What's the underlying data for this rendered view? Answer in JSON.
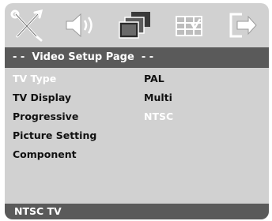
{
  "toolbar": {
    "icons": [
      {
        "name": "general-setup-icon"
      },
      {
        "name": "audio-setup-icon"
      },
      {
        "name": "video-setup-icon"
      },
      {
        "name": "preference-setup-icon"
      },
      {
        "name": "exit-setup-icon"
      }
    ]
  },
  "page": {
    "title": "- -  Video Setup Page  - -"
  },
  "menu": {
    "items": [
      {
        "label": "TV Type",
        "option": "PAL",
        "highlighted": true
      },
      {
        "label": "TV Display",
        "option": "Multi",
        "highlighted": false
      },
      {
        "label": "Progressive",
        "option": "NTSC",
        "highlighted": false
      },
      {
        "label": "Picture Setting",
        "option": "",
        "highlighted": false
      },
      {
        "label": "Component",
        "option": "",
        "highlighted": false
      }
    ]
  },
  "status": {
    "text": "NTSC TV"
  },
  "colors": {
    "panel": "#d1d1d1",
    "bar": "#5a5a5a",
    "highlight_text": "#ffffff",
    "normal_text": "#111111"
  }
}
